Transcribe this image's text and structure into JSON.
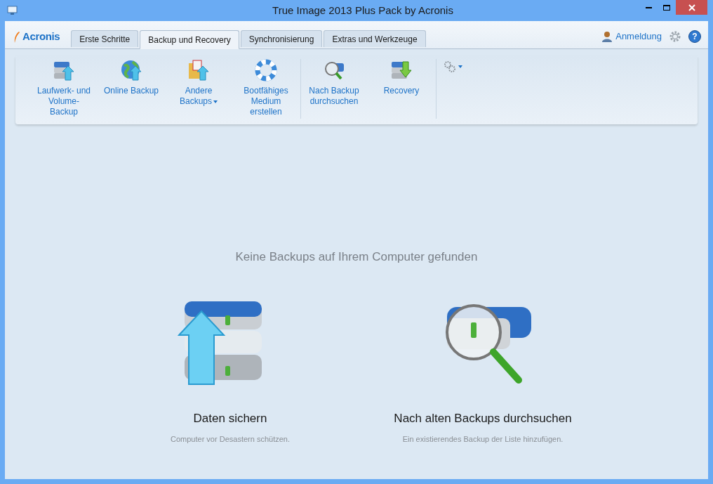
{
  "window": {
    "title": "True Image 2013 Plus Pack by Acronis"
  },
  "logo": "Acronis",
  "tabs": [
    {
      "label": "Erste Schritte",
      "selected": false
    },
    {
      "label": "Backup und Recovery",
      "selected": true
    },
    {
      "label": "Synchronisierung",
      "selected": false
    },
    {
      "label": "Extras und Werkzeuge",
      "selected": false
    }
  ],
  "header_links": {
    "login": "Anmeldung",
    "help": "?"
  },
  "toolbar": {
    "groups": [
      [
        {
          "kind": "drive-up",
          "lines": [
            "Laufwerk- und",
            "Volume-",
            "Backup"
          ],
          "dropdown": false
        },
        {
          "kind": "globe-up",
          "lines": [
            "Online Backup"
          ],
          "dropdown": false
        },
        {
          "kind": "folder-up",
          "lines": [
            "Andere",
            "Backups"
          ],
          "dropdown": true
        },
        {
          "kind": "lifebuoy",
          "lines": [
            "Bootfähiges",
            "Medium",
            "erstellen"
          ],
          "dropdown": false
        }
      ],
      [
        {
          "kind": "drive-search",
          "lines": [
            "Nach Backup",
            "durchsuchen"
          ],
          "dropdown": false
        },
        {
          "kind": "drive-down",
          "lines": [
            "Recovery"
          ],
          "dropdown": false
        }
      ],
      [
        {
          "kind": "gears",
          "dropdown": true
        }
      ]
    ]
  },
  "main": {
    "message": "Keine Backups auf Ihrem Computer gefunden",
    "actions": [
      {
        "kind": "backup",
        "title": "Daten sichern",
        "description": "Computer vor Desastern schützen."
      },
      {
        "kind": "search",
        "title": "Nach alten Backups durchsuchen",
        "description": "Ein existierendes Backup der Liste hinzufügen."
      }
    ]
  }
}
